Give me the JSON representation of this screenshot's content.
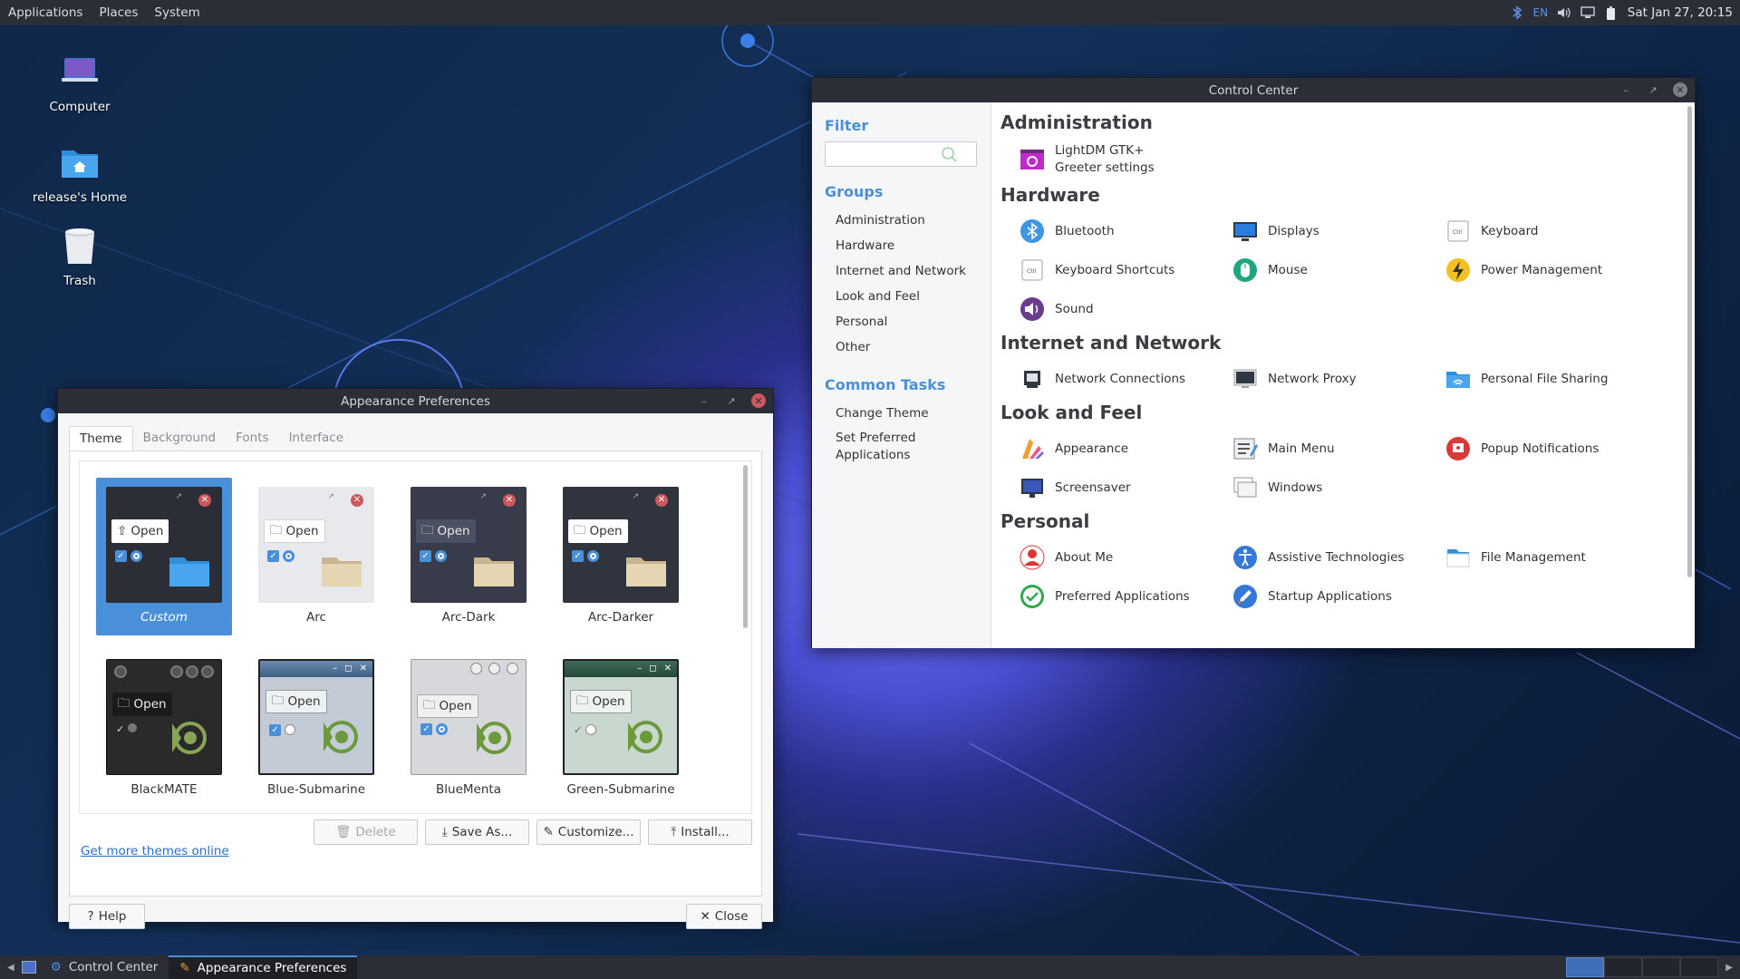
{
  "top_panel": {
    "menus": [
      "Applications",
      "Places",
      "System"
    ],
    "keyboard_layout": "EN",
    "clock": "Sat Jan 27, 20:15"
  },
  "desktop": {
    "icons": [
      {
        "label": "Computer",
        "icon": "computer-icon"
      },
      {
        "label": "release's Home",
        "icon": "home-folder-icon"
      },
      {
        "label": "Trash",
        "icon": "trash-icon"
      }
    ]
  },
  "control_center": {
    "title": "Control Center",
    "filter_heading": "Filter",
    "groups_heading": "Groups",
    "groups": [
      "Administration",
      "Hardware",
      "Internet and Network",
      "Look and Feel",
      "Personal",
      "Other"
    ],
    "tasks_heading": "Common Tasks",
    "tasks": [
      "Change Theme",
      "Set Preferred Applications"
    ],
    "sections": [
      {
        "title": "Administration",
        "items": [
          {
            "label": "LightDM GTK+ Greeter settings",
            "icon": "greeter-settings-icon"
          }
        ]
      },
      {
        "title": "Hardware",
        "items": [
          {
            "label": "Bluetooth",
            "icon": "bluetooth-icon"
          },
          {
            "label": "Displays",
            "icon": "display-icon"
          },
          {
            "label": "Keyboard",
            "icon": "keyboard-icon"
          },
          {
            "label": "Keyboard Shortcuts",
            "icon": "keyboard-shortcuts-icon"
          },
          {
            "label": "Mouse",
            "icon": "mouse-icon"
          },
          {
            "label": "Power Management",
            "icon": "power-icon"
          },
          {
            "label": "Sound",
            "icon": "sound-icon"
          }
        ]
      },
      {
        "title": "Internet and Network",
        "items": [
          {
            "label": "Network Connections",
            "icon": "network-connections-icon"
          },
          {
            "label": "Network Proxy",
            "icon": "network-proxy-icon"
          },
          {
            "label": "Personal File Sharing",
            "icon": "file-sharing-icon"
          }
        ]
      },
      {
        "title": "Look and Feel",
        "items": [
          {
            "label": "Appearance",
            "icon": "appearance-icon"
          },
          {
            "label": "Main Menu",
            "icon": "main-menu-icon"
          },
          {
            "label": "Popup Notifications",
            "icon": "notifications-icon"
          },
          {
            "label": "Screensaver",
            "icon": "screensaver-icon"
          },
          {
            "label": "Windows",
            "icon": "windows-icon"
          }
        ]
      },
      {
        "title": "Personal",
        "items": [
          {
            "label": "About Me",
            "icon": "about-me-icon"
          },
          {
            "label": "Assistive Technologies",
            "icon": "accessibility-icon"
          },
          {
            "label": "File Management",
            "icon": "file-management-icon"
          },
          {
            "label": "Preferred Applications",
            "icon": "preferred-apps-icon"
          },
          {
            "label": "Startup Applications",
            "icon": "startup-apps-icon"
          }
        ]
      }
    ]
  },
  "appearance": {
    "title": "Appearance Preferences",
    "tabs": [
      "Theme",
      "Background",
      "Fonts",
      "Interface"
    ],
    "active_tab": "Theme",
    "preview_button_label": "Open",
    "themes": [
      "Custom",
      "Arc",
      "Arc-Dark",
      "Arc-Darker",
      "BlackMATE",
      "Blue-Submarine",
      "BlueMenta",
      "Green-Submarine"
    ],
    "selected_theme": "Custom",
    "buttons": {
      "delete": "Delete",
      "save_as": "Save As...",
      "customize": "Customize...",
      "install": "Install..."
    },
    "get_more_link": "Get more themes online",
    "help": "Help",
    "close": "Close"
  },
  "taskbar": {
    "items": [
      "Control Center",
      "Appearance Preferences"
    ],
    "active": "Appearance Preferences"
  },
  "colors": {
    "accent": "#4a90d9",
    "panel": "#2b2e37",
    "close": "#cc575d"
  }
}
